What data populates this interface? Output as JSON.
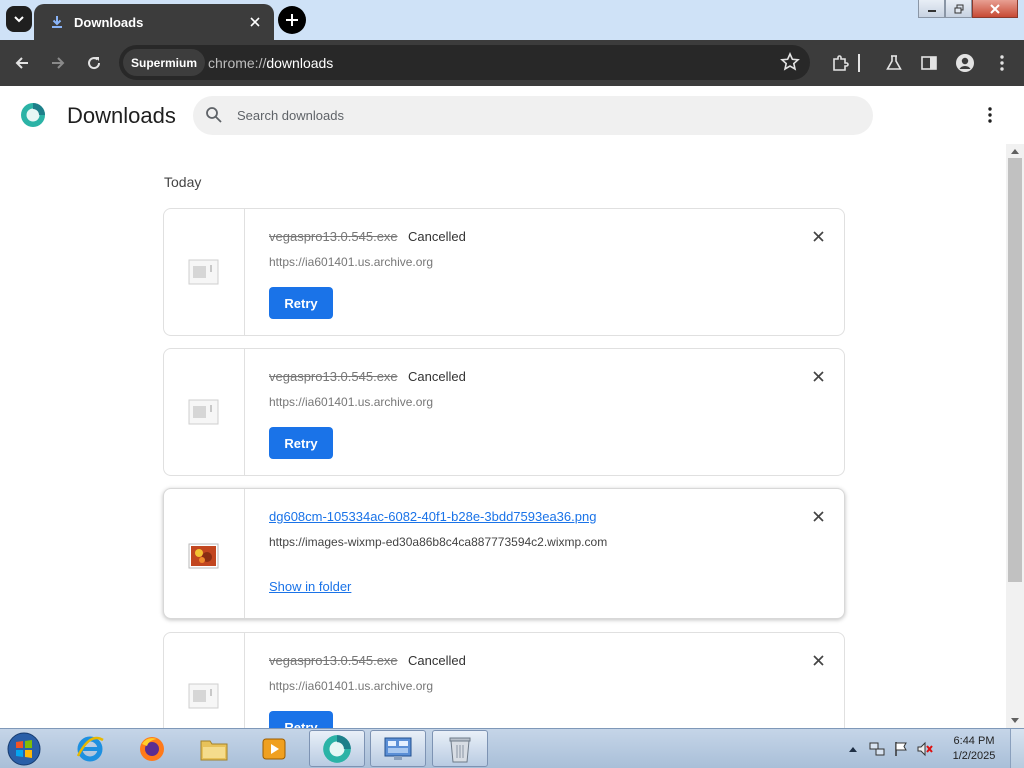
{
  "browser": {
    "tab_title": "Downloads",
    "site_chip": "Supermium",
    "url_prefix": "chrome://",
    "url_path": "downloads"
  },
  "page": {
    "title": "Downloads",
    "search_placeholder": "Search downloads",
    "date_heading": "Today"
  },
  "downloads": [
    {
      "filename": "vegaspro13.0.545.exe",
      "status": "Cancelled",
      "source": "https://ia601401.us.archive.org",
      "action": "Retry"
    },
    {
      "filename": "vegaspro13.0.545.exe",
      "status": "Cancelled",
      "source": "https://ia601401.us.archive.org",
      "action": "Retry"
    },
    {
      "filename": "dg608cm-105334ac-6082-40f1-b28e-3bdd7593ea36.png",
      "status": "",
      "source": "https://images-wixmp-ed30a86b8c4ca887773594c2.wixmp.com",
      "action": "Show in folder"
    },
    {
      "filename": "vegaspro13.0.545.exe",
      "status": "Cancelled",
      "source": "https://ia601401.us.archive.org",
      "action": "Retry"
    }
  ],
  "taskbar": {
    "time": "6:44 PM",
    "date": "1/2/2025"
  },
  "colors": {
    "accent": "#1a73e8",
    "toolbar": "#3c3c3c",
    "tabstrip": "#cfe2f7"
  }
}
